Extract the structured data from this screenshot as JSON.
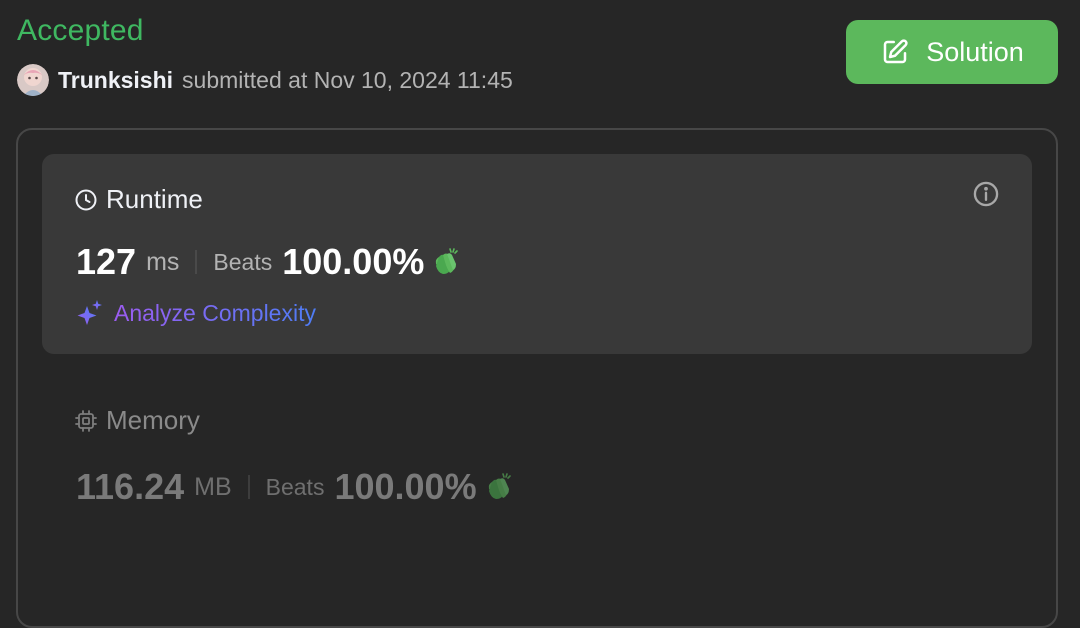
{
  "header": {
    "status": "Accepted",
    "username": "Trunksishi",
    "submitted_text": "submitted at Nov 10, 2024 11:45",
    "solution_label": "Solution"
  },
  "runtime": {
    "title": "Runtime",
    "value": "127",
    "unit": "ms",
    "beats_label": "Beats",
    "beats_value": "100.00%",
    "analyze_label": "Analyze Complexity"
  },
  "memory": {
    "title": "Memory",
    "value": "116.24",
    "unit": "MB",
    "beats_label": "Beats",
    "beats_value": "100.00%"
  },
  "colors": {
    "accepted": "#3fb861",
    "solution_button": "#5cb85c",
    "clap": "#5cb85c",
    "analyze_gradient_start": "#9c5cf0",
    "analyze_gradient_end": "#4e7df5"
  },
  "icons": {
    "avatar": "user-avatar",
    "solution": "edit-icon",
    "runtime": "clock-icon",
    "info": "info-icon",
    "clap": "clap-icon",
    "analyze": "sparkle-icon",
    "memory": "chip-icon"
  }
}
